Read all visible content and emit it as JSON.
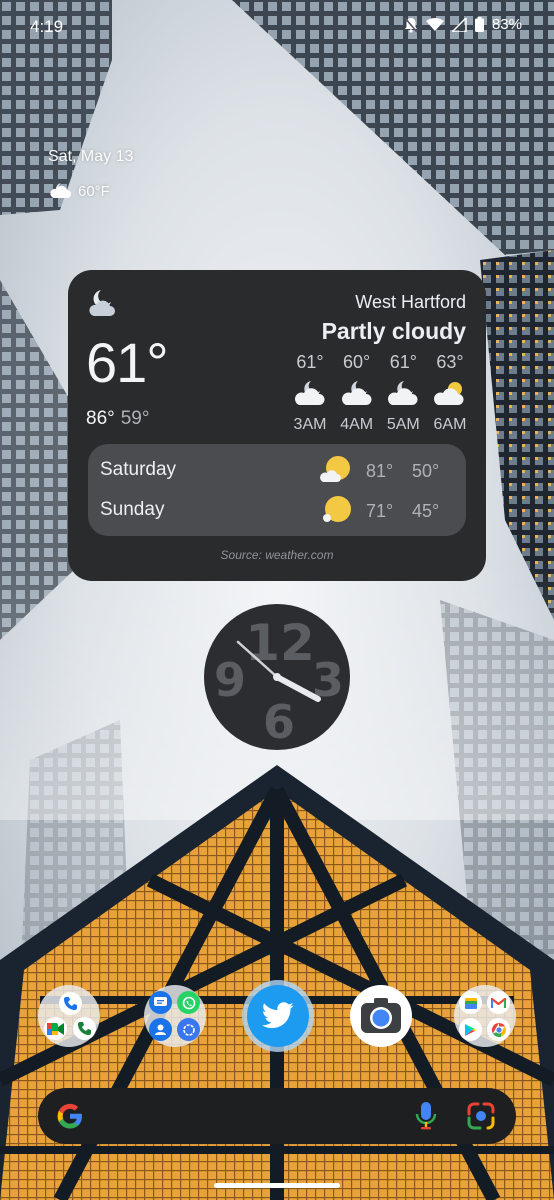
{
  "status_bar": {
    "time": "4:19",
    "battery": "83%",
    "icons": [
      "do-not-disturb-bell-off-icon",
      "wifi-icon",
      "signal-icon",
      "battery-icon"
    ]
  },
  "at_a_glance": {
    "date": "Sat, May 13",
    "temperature": "60°F",
    "icon": "partly-cloudy-night-icon"
  },
  "weather_widget": {
    "location": "West Hartford",
    "condition": "Partly cloudy",
    "current_temp": "61°",
    "high": "86°",
    "low": "59°",
    "hourly": [
      {
        "temp": "61°",
        "time": "3AM",
        "icon": "partly-cloudy-night-icon"
      },
      {
        "temp": "60°",
        "time": "4AM",
        "icon": "partly-cloudy-night-icon"
      },
      {
        "temp": "61°",
        "time": "5AM",
        "icon": "partly-cloudy-night-icon"
      },
      {
        "temp": "63°",
        "time": "6AM",
        "icon": "partly-sunny-icon"
      }
    ],
    "daily": [
      {
        "day": "Saturday",
        "high": "81°",
        "low": "50°",
        "icon": "partly-sunny-icon"
      },
      {
        "day": "Sunday",
        "high": "71°",
        "low": "45°",
        "icon": "sunny-icon"
      }
    ],
    "source": "Source: weather.com"
  },
  "clock": {
    "numerals": [
      "12",
      "3",
      "6",
      "9"
    ],
    "time": "4:19"
  },
  "dock": [
    {
      "type": "folder",
      "apps": [
        "phone-icon",
        "google-meet-icon",
        "google-voice-icon"
      ]
    },
    {
      "type": "folder",
      "apps": [
        "messages-icon",
        "whatsapp-icon",
        "contacts-icon",
        "signal-icon"
      ]
    },
    {
      "type": "app",
      "icon": "twitter-icon"
    },
    {
      "type": "app",
      "icon": "camera-icon"
    },
    {
      "type": "folder",
      "apps": [
        "google-wallet-icon",
        "gmail-icon",
        "play-store-icon",
        "chrome-icon"
      ]
    }
  ],
  "search_bar": {
    "icons": [
      "google-g-icon",
      "microphone-icon",
      "google-lens-icon"
    ]
  },
  "colors": {
    "widget_bg": "#2a2b2d",
    "forecast_bg": "#4a4c50",
    "search_bg": "#1e1f21",
    "sun": "#f3c943",
    "twitter": "#1d9bf0"
  }
}
